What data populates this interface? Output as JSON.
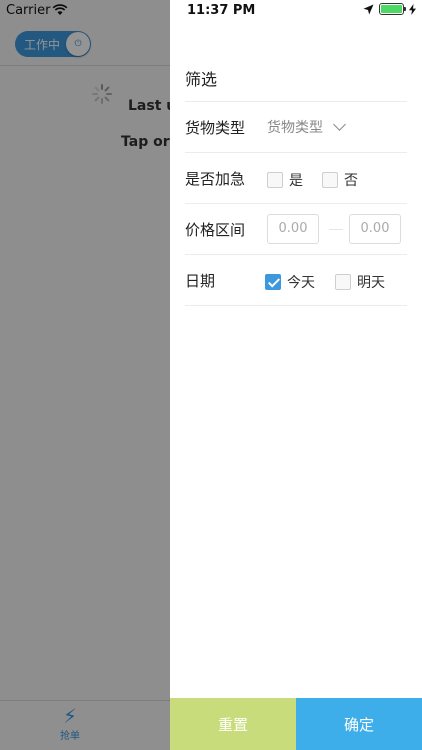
{
  "background": {
    "carrier": "Carrier",
    "work_toggle_label": "工作中",
    "last_update_text": "Last u",
    "tap_text": "Tap or p",
    "tab_label": "抢单"
  },
  "status_bar": {
    "time": "11:37 PM"
  },
  "filter": {
    "title": "筛选",
    "cargo_type": {
      "label": "货物类型",
      "value": "货物类型"
    },
    "urgent": {
      "label": "是否加急",
      "options": [
        "是",
        "否"
      ]
    },
    "price": {
      "label": "价格区间",
      "min_placeholder": "0.00",
      "max_placeholder": "0.00"
    },
    "date": {
      "label": "日期",
      "options": [
        "今天",
        "明天"
      ],
      "checked": "今天"
    }
  },
  "buttons": {
    "reset": "重置",
    "confirm": "确定"
  },
  "colors": {
    "accent": "#3d98dd",
    "reset": "#c9dc7b",
    "confirm": "#3daee9"
  }
}
